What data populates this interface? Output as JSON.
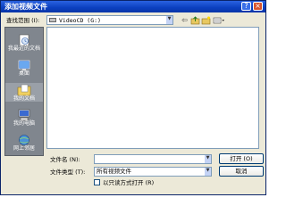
{
  "window": {
    "title": "添加视频文件"
  },
  "lookin": {
    "label": "查找范围 (I):",
    "value": "VideoCD (G:)"
  },
  "sidebar": {
    "items": [
      {
        "label": "我最近的文档",
        "icon": "recent-docs-icon"
      },
      {
        "label": "桌面",
        "icon": "desktop-icon"
      },
      {
        "label": "我的文档",
        "icon": "my-documents-icon"
      },
      {
        "label": "我的电脑",
        "icon": "my-computer-icon"
      },
      {
        "label": "网上邻居",
        "icon": "network-places-icon"
      }
    ]
  },
  "filename": {
    "label": "文件名 (N):",
    "value": ""
  },
  "filetype": {
    "label": "文件类型 (T):",
    "value": "所有视频文件"
  },
  "readonly": {
    "label": "以只读方式打开 (R)",
    "checked": false
  },
  "buttons": {
    "open": "打开 (O)",
    "cancel": "取消"
  },
  "colors": {
    "title_bar": "#0b3fbf",
    "dialog_bg": "#ece9d8",
    "sidebar_bg": "#80868e"
  }
}
